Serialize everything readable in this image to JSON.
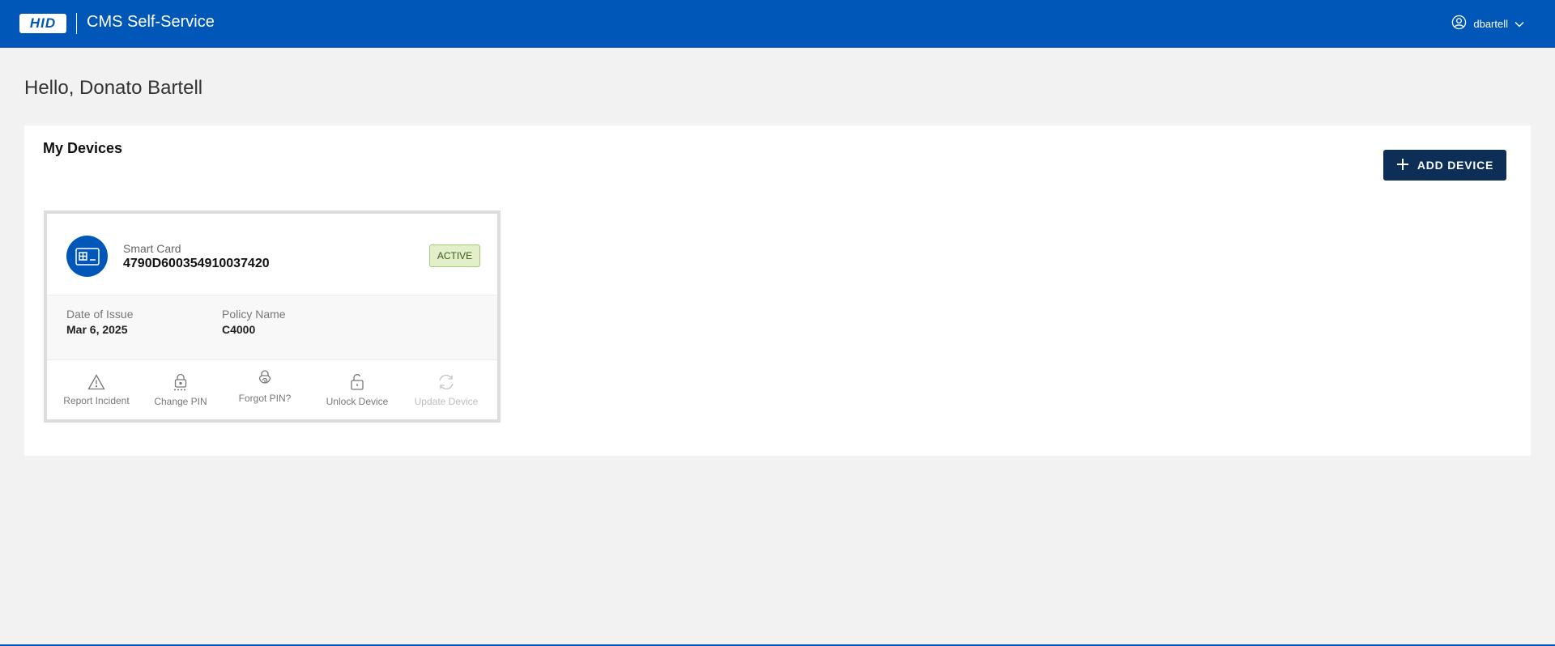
{
  "header": {
    "logo_text": "HID",
    "app_title": "CMS Self-Service",
    "username": "dbartell"
  },
  "greeting": "Hello, Donato Bartell",
  "devices_panel": {
    "title": "My Devices",
    "add_button_label": "ADD DEVICE",
    "devices": [
      {
        "type": "Smart Card",
        "serial": "4790D600354910037420",
        "status": "ACTIVE",
        "date_of_issue_label": "Date of Issue",
        "date_of_issue": "Mar 6, 2025",
        "policy_name_label": "Policy Name",
        "policy_name": "C4000",
        "actions": [
          {
            "label": "Report Incident",
            "icon": "warning-icon",
            "enabled": true
          },
          {
            "label": "Change PIN",
            "icon": "lock-pin-icon",
            "enabled": true
          },
          {
            "label": "Forgot PIN?",
            "icon": "lock-fingerprint-icon",
            "enabled": true
          },
          {
            "label": "Unlock Device",
            "icon": "unlock-icon",
            "enabled": true
          },
          {
            "label": "Update Device",
            "icon": "refresh-icon",
            "enabled": false
          }
        ]
      }
    ]
  },
  "colors": {
    "header_blue": "#0057b8",
    "button_navy": "#0d2f57",
    "active_badge_bg": "#e2efc8"
  }
}
